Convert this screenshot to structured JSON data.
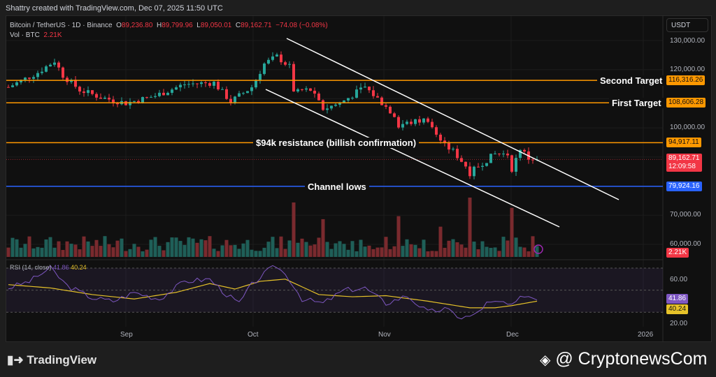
{
  "header": {
    "credit": "Shattry created with TradingView.com, Dec 07, 2025 11:50 UTC"
  },
  "legend": {
    "symbol": "Bitcoin / TetherUS · 1D · Binance",
    "o_label": "O",
    "open": "89,236.80",
    "h_label": "H",
    "high": "89,799.96",
    "l_label": "L",
    "low": "89,050.01",
    "c_label": "C",
    "close": "89,162.71",
    "change": "−74.08 (−0.08%)",
    "vol_label": "Vol · BTC",
    "vol": "2.21K"
  },
  "currency": "USDT",
  "colors": {
    "up": "#26a69a",
    "down": "#f23645",
    "orange": "#ff9800",
    "blue": "#2962ff",
    "rsi": "#7e57c2",
    "rsi_ma": "#e6c229"
  },
  "annotations": {
    "second_target": "Second Target",
    "first_target": "First Target",
    "resistance": "$94k resistance (billish confirmation)",
    "channel_lows": "Channel lows"
  },
  "price_tags": {
    "second_target": "116,316.26",
    "first_target": "108,606.28",
    "resistance": "94,917.11",
    "current": "89,162.71",
    "countdown": "12:09:58",
    "channel_lows": "79,924.16",
    "volume": "2.21K"
  },
  "chart_data": {
    "type": "candlestick",
    "title": "Bitcoin / TetherUS · 1D · Binance",
    "ylim": [
      60000,
      130000
    ],
    "yticks": [
      "130,000.00",
      "120,000.00",
      "100,000.00",
      "70,000.00",
      "60,000.00"
    ],
    "ytick_values": [
      130000,
      120000,
      100000,
      70000,
      60000
    ],
    "xticks": [
      "Sep",
      "Oct",
      "Nov",
      "Dec",
      "2026"
    ],
    "levels": {
      "second_target": 116316.26,
      "first_target": 108606.28,
      "resistance": 94917.11,
      "current": 89162.71,
      "channel_lows": 79924.16
    },
    "close_keypoints_day_value": [
      [
        0,
        114000
      ],
      [
        7,
        119000
      ],
      [
        11,
        123000
      ],
      [
        13,
        118000
      ],
      [
        17,
        113000
      ],
      [
        22,
        110500
      ],
      [
        28,
        108500
      ],
      [
        35,
        111000
      ],
      [
        42,
        115000
      ],
      [
        49,
        115500
      ],
      [
        53,
        109000
      ],
      [
        58,
        114000
      ],
      [
        61,
        122000
      ],
      [
        64,
        124500
      ],
      [
        67,
        121000
      ],
      [
        68,
        113000
      ],
      [
        72,
        113000
      ],
      [
        75,
        106500
      ],
      [
        79,
        108500
      ],
      [
        85,
        114000
      ],
      [
        88,
        110000
      ],
      [
        92,
        104500
      ],
      [
        93,
        101000
      ],
      [
        100,
        103000
      ],
      [
        103,
        95000
      ],
      [
        106,
        92000
      ],
      [
        109,
        87000
      ],
      [
        110,
        84500
      ],
      [
        113,
        88000
      ],
      [
        116,
        91000
      ],
      [
        119,
        91000
      ],
      [
        120,
        86000
      ],
      [
        122,
        93000
      ],
      [
        124,
        89500
      ],
      [
        126,
        89163
      ]
    ],
    "rsi": {
      "label": "RSI (14, close)",
      "value": "41.86",
      "ma_value": "40.24",
      "ylim": [
        15,
        75
      ],
      "yticks": [
        "60.00",
        "20.00"
      ],
      "keypoints": [
        [
          0,
          52
        ],
        [
          5,
          58
        ],
        [
          10,
          70
        ],
        [
          14,
          54
        ],
        [
          20,
          43
        ],
        [
          25,
          40
        ],
        [
          30,
          48
        ],
        [
          36,
          42
        ],
        [
          42,
          58
        ],
        [
          48,
          60
        ],
        [
          52,
          46
        ],
        [
          55,
          38
        ],
        [
          58,
          55
        ],
        [
          62,
          68
        ],
        [
          64,
          72
        ],
        [
          67,
          60
        ],
        [
          70,
          42
        ],
        [
          75,
          38
        ],
        [
          80,
          50
        ],
        [
          85,
          52
        ],
        [
          90,
          38
        ],
        [
          95,
          45
        ],
        [
          100,
          30
        ],
        [
          104,
          33
        ],
        [
          108,
          25
        ],
        [
          111,
          27
        ],
        [
          114,
          38
        ],
        [
          118,
          39
        ],
        [
          120,
          35
        ],
        [
          123,
          46
        ],
        [
          126,
          42
        ]
      ],
      "ma_keypoints": [
        [
          0,
          55
        ],
        [
          10,
          52
        ],
        [
          20,
          46
        ],
        [
          30,
          42
        ],
        [
          40,
          48
        ],
        [
          48,
          56
        ],
        [
          54,
          51
        ],
        [
          60,
          58
        ],
        [
          66,
          60
        ],
        [
          74,
          46
        ],
        [
          82,
          44
        ],
        [
          90,
          45
        ],
        [
          100,
          40
        ],
        [
          110,
          34
        ],
        [
          116,
          34
        ],
        [
          120,
          36
        ],
        [
          126,
          40
        ]
      ]
    }
  },
  "watermarks": {
    "tradingview": "TradingView",
    "cryptonews": "@ CryptonewsCom"
  }
}
